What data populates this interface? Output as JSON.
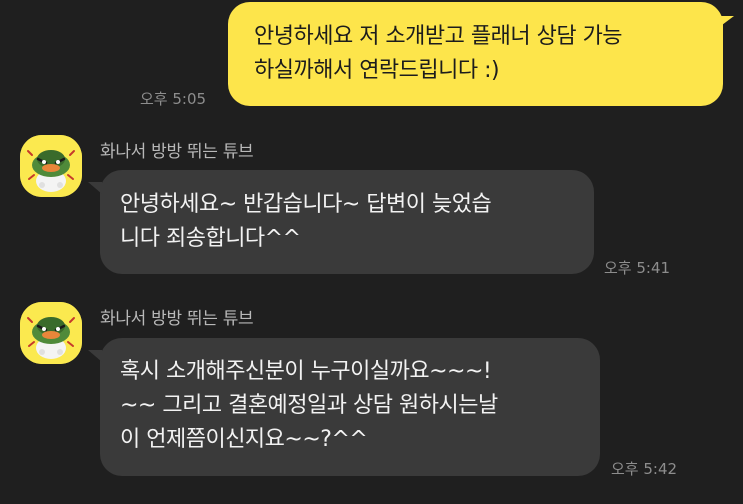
{
  "messages": [
    {
      "side": "me",
      "lines": [
        "안녕하세요 저 소개받고 플래너 상담 가능",
        "하실까해서 연락드립니다 :)"
      ],
      "time": "오후 5:05"
    },
    {
      "side": "other",
      "sender": "화나서 방방 뛰는 튜브",
      "avatar_icon": "tube-character-icon",
      "lines": [
        "안녕하세요~ 반갑습니다~ 답변이 늦었습",
        "니다 죄송합니다^^"
      ],
      "time": "오후 5:41"
    },
    {
      "side": "other",
      "sender": "화나서 방방 뛰는 튜브",
      "avatar_icon": "tube-character-icon",
      "lines": [
        "혹시 소개해주신분이 누구이실까요~~~!",
        "~~ 그리고 결혼예정일과 상담 원하시는날",
        "이 언제쯤이신지요~~?^^"
      ],
      "time": "오후 5:42"
    }
  ],
  "colors": {
    "background": "#1f1f1f",
    "my_bubble": "#fde54b",
    "other_bubble": "#3a3a3a",
    "avatar_bg": "#fbe94f"
  }
}
